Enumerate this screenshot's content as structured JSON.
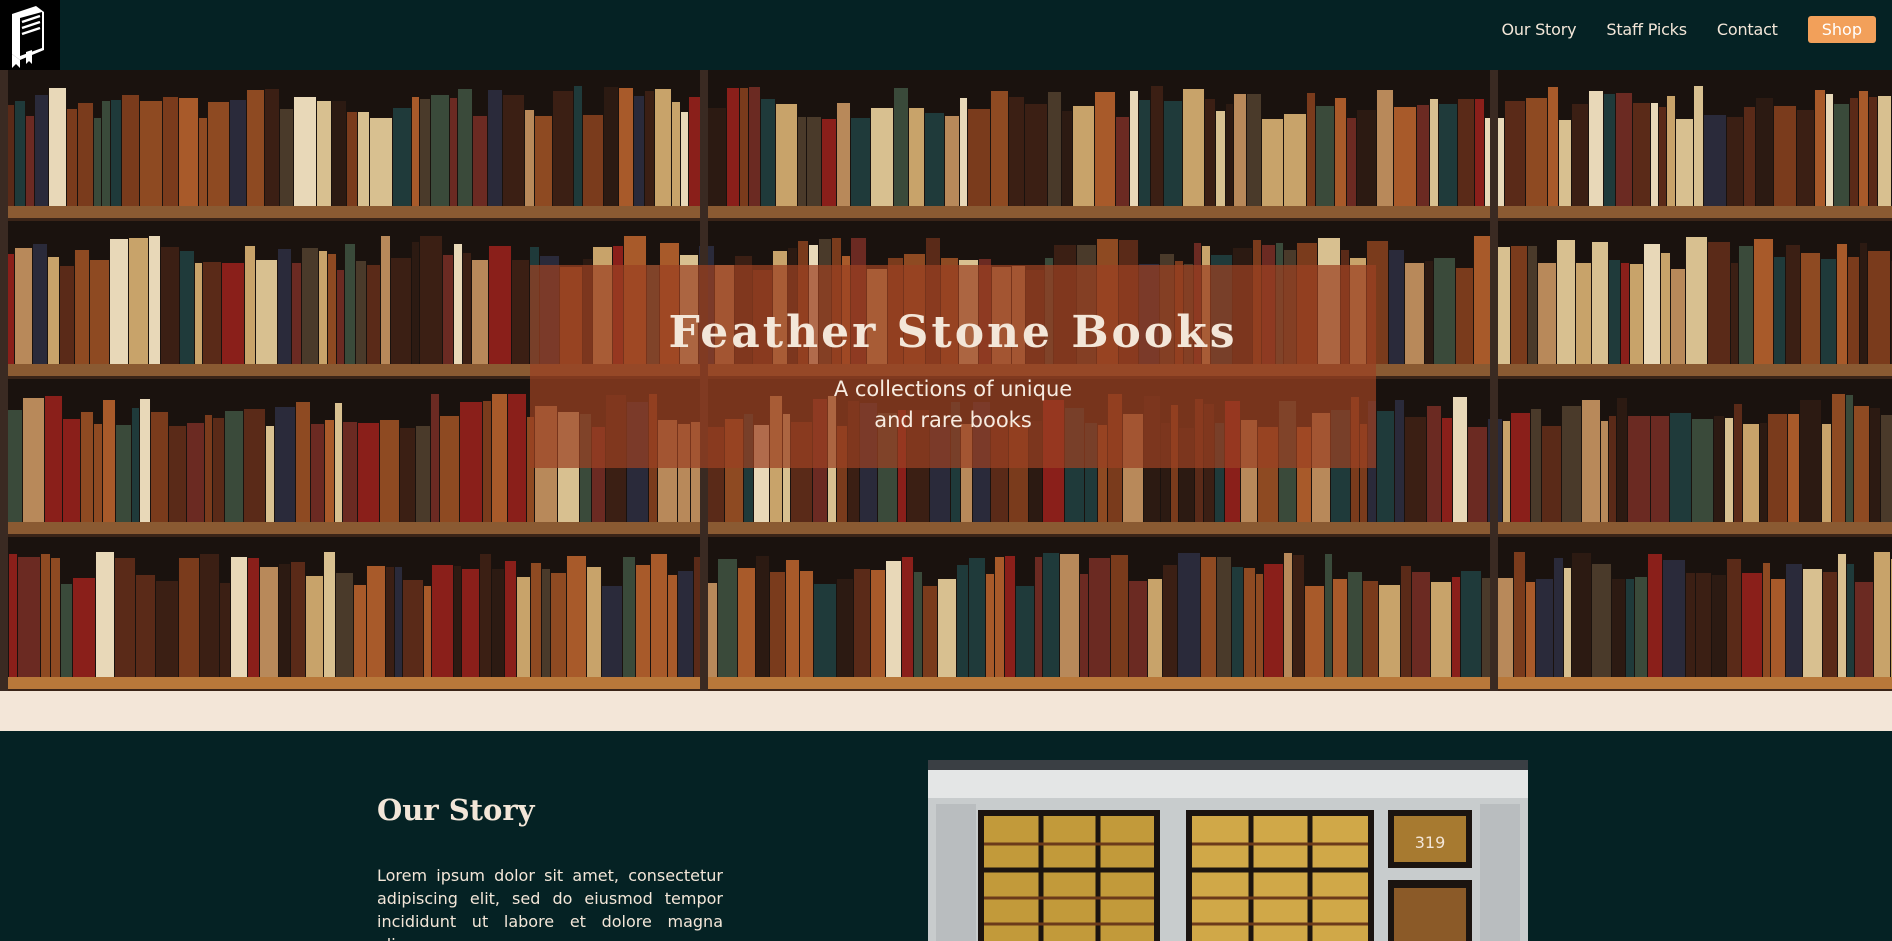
{
  "nav": {
    "logo_icon": "book-icon",
    "links": [
      "Our Story",
      "Staff Picks",
      "Contact"
    ],
    "shop_label": "Shop"
  },
  "hero": {
    "title": "Feather Stone Books",
    "subtitle_line1": "A collections of unique",
    "subtitle_line2": "and rare books",
    "image": "bookshelf-photo"
  },
  "story": {
    "title": "Our Story",
    "text": "Lorem ipsum dolor sit amet, consectetur adipiscing elit, sed do eiusmod tempor incididunt ut labore et dolore magna aliqua.",
    "image": "bookstore-window-photo",
    "sign_number": "319"
  },
  "colors": {
    "nav_bg": "#052224",
    "accent": "#f2a05a",
    "cream": "#f3e6d8",
    "overlay": "#9b4123"
  }
}
